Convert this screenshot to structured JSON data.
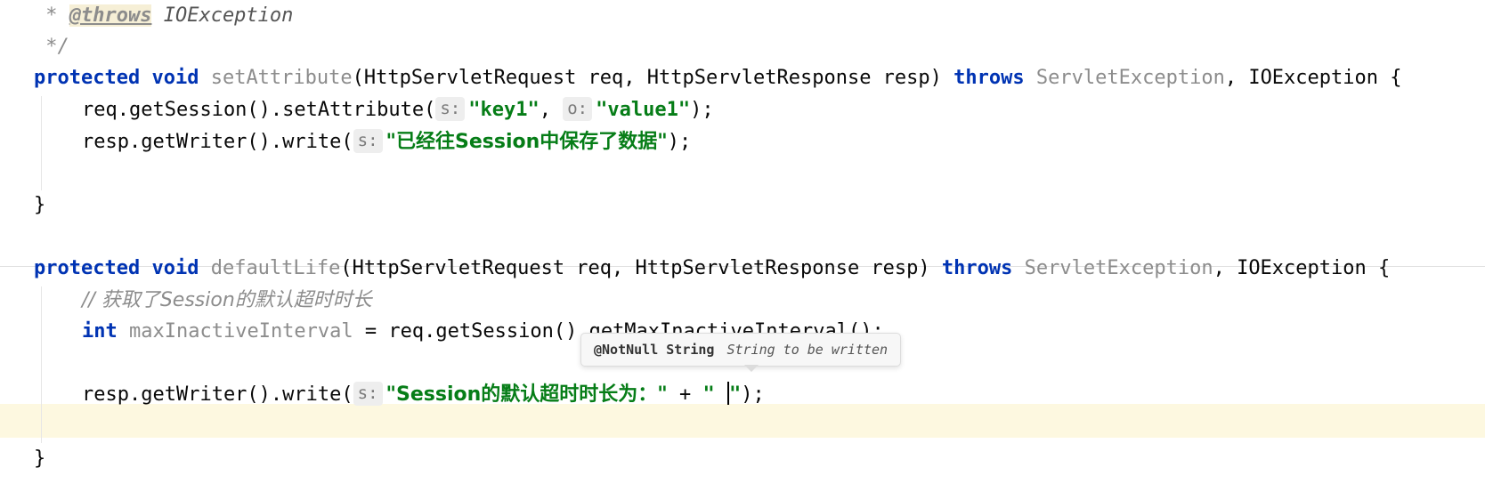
{
  "editor": {
    "doc_prefix": " * ",
    "doc_tag": "@throws",
    "doc_exception": " IOException",
    "doc_close": " */",
    "m1": {
      "kw_protected": "protected",
      "kw_void": "void",
      "name": "setAttribute",
      "params": "(HttpServletRequest req, HttpServletResponse resp) ",
      "kw_throws": "throws",
      "exc1": "ServletException",
      "exc_rest": ", IOException {",
      "l1_call": "req.getSession().setAttribute(",
      "l1_hint1": "s:",
      "l1_str1": "\"key1\"",
      "l1_sep": ", ",
      "l1_hint2": "o:",
      "l1_str2": "\"value1\"",
      "l1_end": ");",
      "l2_call": "resp.getWriter().write(",
      "l2_hint": "s:",
      "l2_str": "\"已经往Session中保存了数据\"",
      "l2_end": ");",
      "close": "}"
    },
    "m2": {
      "kw_protected": "protected",
      "kw_void": "void",
      "name": "defaultLife",
      "params": "(HttpServletRequest req, HttpServletResponse resp) ",
      "kw_throws": "throws",
      "exc1": "ServletException",
      "exc_rest": ", IOException {",
      "comment": "// 获取了Session的默认超时时长",
      "l2_kw_int": "int",
      "l2_var": "maxInactiveInterval",
      "l2_rest": " = req.getSession().getMaxInactiveInterval();",
      "l3_call": "resp.getWriter().write(",
      "l3_hint": "s:",
      "l3_str1": "\"Session的默认超时时长为：\"",
      "l3_plus": " + ",
      "l3_str2_open": "\" ",
      "l3_str2_close": "\"",
      "l3_end": ");",
      "close": "}"
    },
    "tooltip": {
      "signature": "@NotNull String",
      "description": "String to be written"
    }
  }
}
